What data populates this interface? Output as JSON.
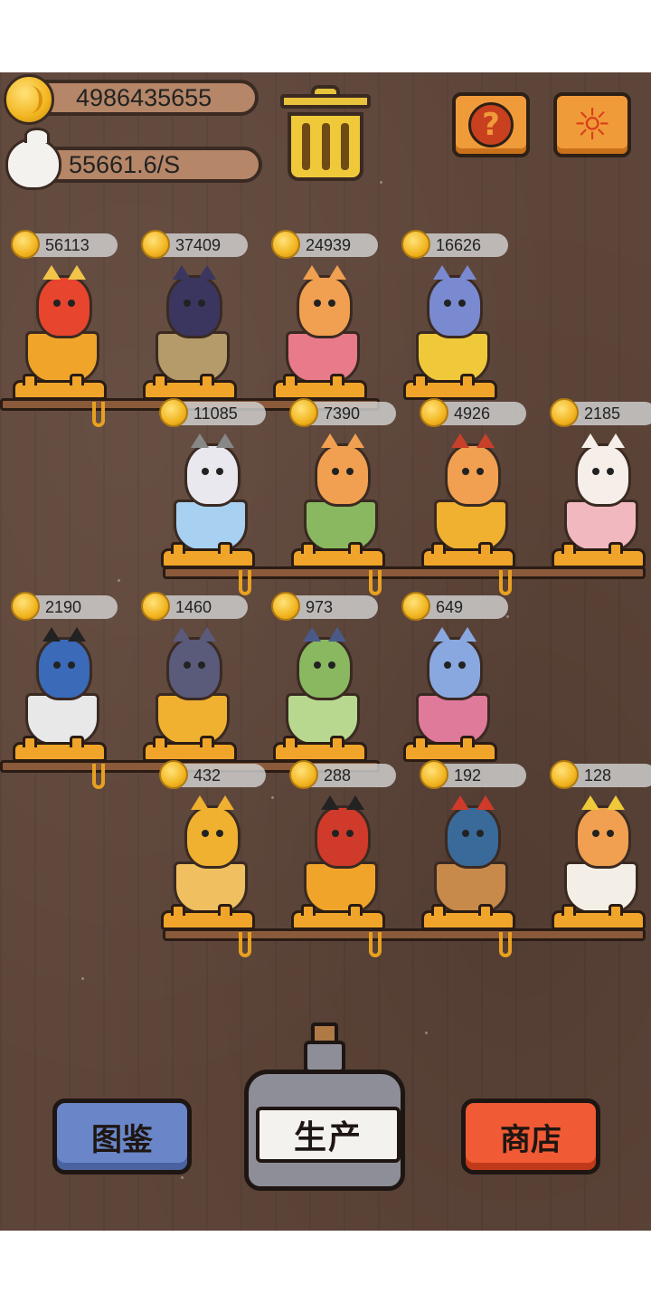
{
  "hud": {
    "coins": "4986435655",
    "rate": "55661.6/S",
    "coin_icon": "gold-coin-icon",
    "bag_icon": "money-bag-icon",
    "trash_icon": "trash-can-icon",
    "help_glyph": "?",
    "settings_glyph": "☼"
  },
  "rows": [
    {
      "slots": [
        {
          "price": "56113",
          "cat": "gold-crown-cat",
          "body": "#e8452e",
          "cup": "#f0a52a",
          "ear": "#f2c44a"
        },
        {
          "price": "37409",
          "cat": "black-cat-grapes",
          "body": "#3a3660",
          "cup": "#b59a6a",
          "ear": "#3a3660"
        },
        {
          "price": "24939",
          "cat": "orange-cat-cocktail",
          "body": "#f0a050",
          "cup": "#e87a8a",
          "ear": "#f0a050"
        },
        {
          "price": "16626",
          "cat": "wizard-cat-beer",
          "body": "#7a8ad0",
          "cup": "#f0c93b",
          "ear": "#7a8ad0"
        }
      ]
    },
    {
      "slots": [
        {
          "price": "11085",
          "cat": "grey-cat-detective",
          "body": "#e8e8ee",
          "cup": "#a8d0f0",
          "ear": "#888"
        },
        {
          "price": "7390",
          "cat": "orange-cat-blue-cape",
          "body": "#f0a050",
          "cup": "#8ab860",
          "ear": "#f0a050"
        },
        {
          "price": "4926",
          "cat": "red-hat-cat-juice",
          "body": "#f0a050",
          "cup": "#f0b030",
          "ear": "#c8402a"
        },
        {
          "price": "2185",
          "cat": "white-cat-rose",
          "body": "#f6eee8",
          "cup": "#f2b8c0",
          "ear": "#f6eee8"
        }
      ]
    },
    {
      "slots": [
        {
          "price": "2190",
          "cat": "white-cat-blue-suit",
          "body": "#3a6ab8",
          "cup": "#e8e8e8",
          "ear": "#222"
        },
        {
          "price": "1460",
          "cat": "two-cats-beer",
          "body": "#5a5a7a",
          "cup": "#f0b030",
          "ear": "#5a5a7a"
        },
        {
          "price": "973",
          "cat": "sunflower-cat-matcha",
          "body": "#8ab860",
          "cup": "#b8d890",
          "ear": "#4a5a88"
        },
        {
          "price": "649",
          "cat": "blue-cat-wine",
          "body": "#8aa8e0",
          "cup": "#e07a9a",
          "ear": "#8aa8e0"
        }
      ]
    },
    {
      "slots": [
        {
          "price": "432",
          "cat": "orange-cat-sunglasses",
          "body": "#f0b030",
          "cup": "#f0c060",
          "ear": "#f0b030"
        },
        {
          "price": "288",
          "cat": "calico-cat-red-jacket",
          "body": "#d03a2a",
          "cup": "#f0a52a",
          "ear": "#222"
        },
        {
          "price": "192",
          "cat": "blue-cat-tomato",
          "body": "#3a6a9a",
          "cup": "#c88a4a",
          "ear": "#d03a2a"
        },
        {
          "price": "128",
          "cat": "emperor-cat-coffee",
          "body": "#f0a050",
          "cup": "#f4efe6",
          "ear": "#f0c93b"
        }
      ]
    }
  ],
  "buttons": {
    "album": "图鉴",
    "produce": "生产",
    "shop": "商店"
  }
}
